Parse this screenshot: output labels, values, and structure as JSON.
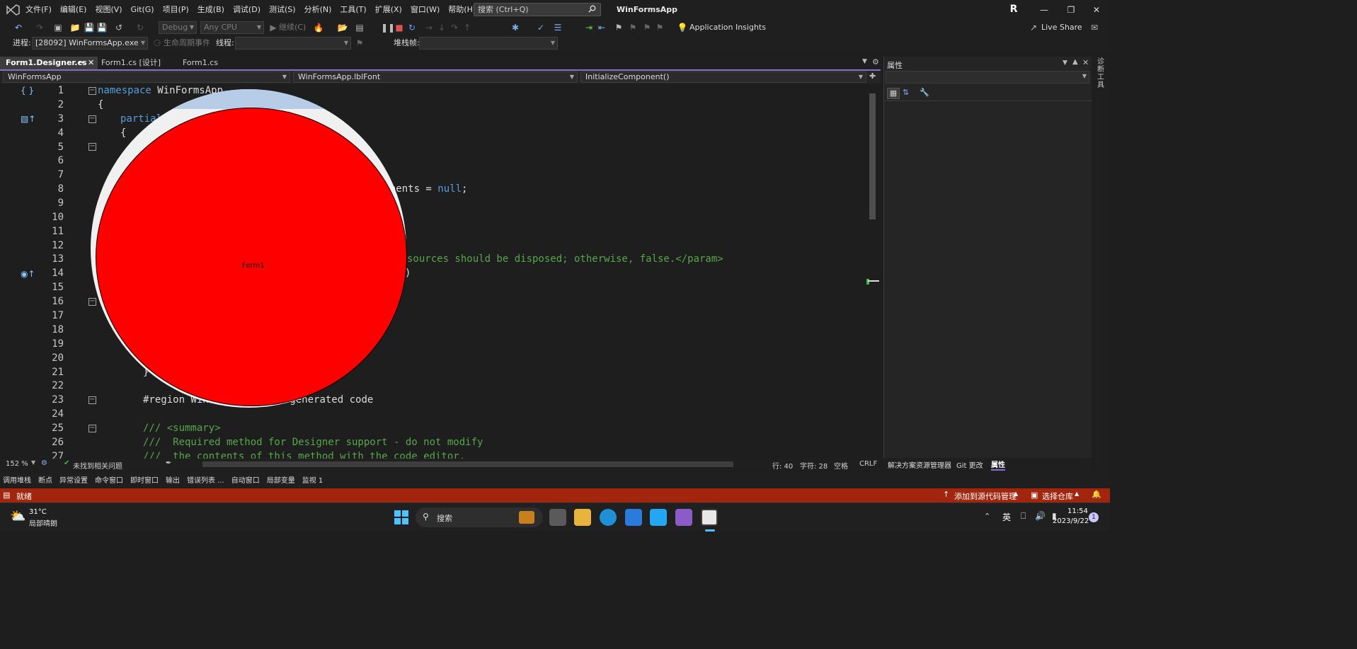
{
  "titlebar": {
    "menus": [
      "文件(F)",
      "编辑(E)",
      "视图(V)",
      "Git(G)",
      "项目(P)",
      "生成(B)",
      "调试(D)",
      "测试(S)",
      "分析(N)",
      "工具(T)",
      "扩展(X)",
      "窗口(W)",
      "帮助(H)"
    ],
    "search_placeholder": "搜索 (Ctrl+Q)",
    "app_title": "WinFormsApp",
    "account_initial": "R"
  },
  "toolbar": {
    "config": "Debug",
    "platform": "Any CPU",
    "continue_label": "继续(C)",
    "app_insights": "Application Insights",
    "live_share": "Live Share",
    "process_label": "进程:",
    "process_value": "[28092] WinFormsApp.exe",
    "lifecycle_label": "生命周期事件",
    "thread_label": "线程:",
    "stackframe_label": "堆栈帧:"
  },
  "tabs": [
    {
      "label": "Form1.Designer.cs",
      "active": true
    },
    {
      "label": "Form1.cs [设计]",
      "active": false
    },
    {
      "label": "Form1.cs",
      "active": false
    }
  ],
  "nav": {
    "project": "WinFormsApp",
    "member": "WinFormsApp.lblFont",
    "method": "InitializeComponent()"
  },
  "editor": {
    "line_numbers": [
      "1",
      "2",
      "3",
      "4",
      "5",
      "6",
      "7",
      "8",
      "9",
      "10",
      "11",
      "12",
      "13",
      "14",
      "15",
      "16",
      "17",
      "18",
      "19",
      "20",
      "21",
      "22",
      "23",
      "24",
      "25",
      "26",
      "27"
    ],
    "line1_kw": "namespace",
    "line1_name": " WinFormsApp",
    "line2": "{",
    "line3_kw": "partial",
    "line4": "{",
    "line8_tail": "ponents = ",
    "line8_null": "null",
    "line8_semi": ";",
    "line13_comment": "sources should be disposed; otherwise, false.</param>",
    "line14_tail": ")",
    "line21": "}",
    "line23_region": "#region Wind",
    "line23_tail": "gner generated code",
    "line25": "/// <summary>",
    "line26": "///  Required method for Designer support - do not modify",
    "line27": "///  the contents of this method with the code editor."
  },
  "form_overlay": {
    "caption": "Form1"
  },
  "editor_status": {
    "zoom": "152 %",
    "issues": "未找到相关问题",
    "line": "行: 40",
    "char": "字符: 28",
    "spaces": "空格",
    "eol": "CRLF"
  },
  "properties_panel": {
    "title": "属性",
    "tabs": [
      "解决方案资源管理器",
      "Git 更改",
      "属性"
    ],
    "side_tab": "诊断工具"
  },
  "bottom_tabs": [
    "调用堆栈",
    "断点",
    "异常设置",
    "命令窗口",
    "即时窗口",
    "输出",
    "错误列表 ...",
    "自动窗口",
    "局部变量",
    "监视 1"
  ],
  "statusbar": {
    "state": "就绪",
    "add_source_control": "添加到源代码管理",
    "select_repo": "选择仓库"
  },
  "taskbar": {
    "weather_temp": "31°C",
    "weather_desc": "局部晴朗",
    "search": "搜索",
    "ime": "英",
    "time": "11:54",
    "date": "2023/9/22",
    "notif_count": "1"
  },
  "colors": {
    "accent": "#8a6fd1",
    "statusbar": "#a1260d",
    "form_fill": "#ff0000"
  }
}
